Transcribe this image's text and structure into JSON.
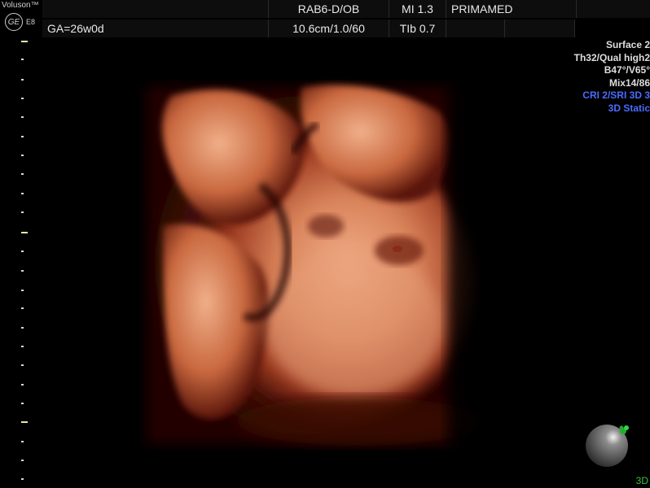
{
  "header": {
    "brand": "Voluson™",
    "logo_mark": "GE",
    "model": "E8",
    "probe": "RAB6-D/OB",
    "mi": "MI 1.3",
    "institution": "PRIMAMED",
    "ga": "GA=26w0d",
    "depth_settings": "10.6cm/1.0/60",
    "tib": "TIb 0.7"
  },
  "params": {
    "line1": "Surface 2",
    "line2": "Th32/Qual high2",
    "line3": "B47°/V65°",
    "line4": "Mix14/86",
    "line5": "CRI 2/SRI 3D 3",
    "line6": "3D Static"
  },
  "mode_indicator": "3D",
  "colors": {
    "background": "#000000",
    "param_blue": "#4a6cff",
    "mode_green": "#3fbf3f",
    "render_skin": "#d98a62",
    "render_shadow": "#7a1e10"
  },
  "icons": {
    "logo": "ge-logo-icon",
    "orientation": "orientation-ball-icon"
  }
}
